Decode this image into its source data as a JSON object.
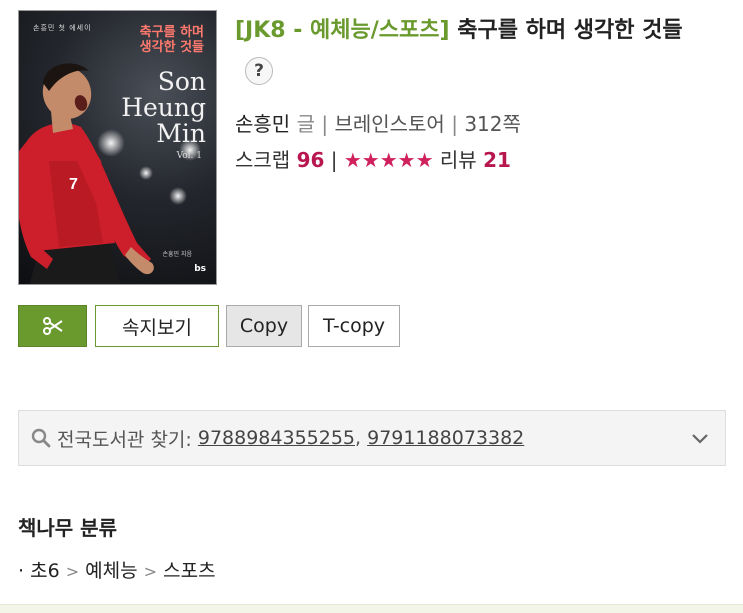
{
  "book": {
    "category": "[JK8 - 예체능/스포츠]",
    "title": "축구를 하며 생각한 것들",
    "help_label": "?",
    "author": "손흥민",
    "author_role": "글",
    "publisher": "브레인스토어",
    "pages": "312쪽",
    "scrap_label": "스크랩",
    "scrap_count": "96",
    "stars": "★★★★★",
    "review_label": "리뷰",
    "review_count": "21"
  },
  "cover": {
    "small_text": "손흥민 첫 에세이",
    "title_line1": "축구를  하며",
    "title_line2": "생각한  것들",
    "name_line1": "Son",
    "name_line2": "Heung",
    "name_line3": "Min",
    "vol": "Vol. 1",
    "author": "손흥민 지음",
    "logo": "bs",
    "jersey_number": "7"
  },
  "actions": {
    "scissor_icon": "scissors-icon",
    "sokji_label": "속지보기",
    "copy_label": "Copy",
    "tcopy_label": "T-copy"
  },
  "library": {
    "label": "전국도서관 찾기:",
    "isbn1": "9788984355255",
    "comma": ",",
    "isbn2": "9791188073382"
  },
  "classification": {
    "heading": "책나무 분류",
    "bullet": "·",
    "level1": "초6",
    "level2": "예체능",
    "level3": "스포츠",
    "sep": ">"
  },
  "colors": {
    "accent_green": "#6a9a2e",
    "accent_pink": "#b7164f"
  }
}
